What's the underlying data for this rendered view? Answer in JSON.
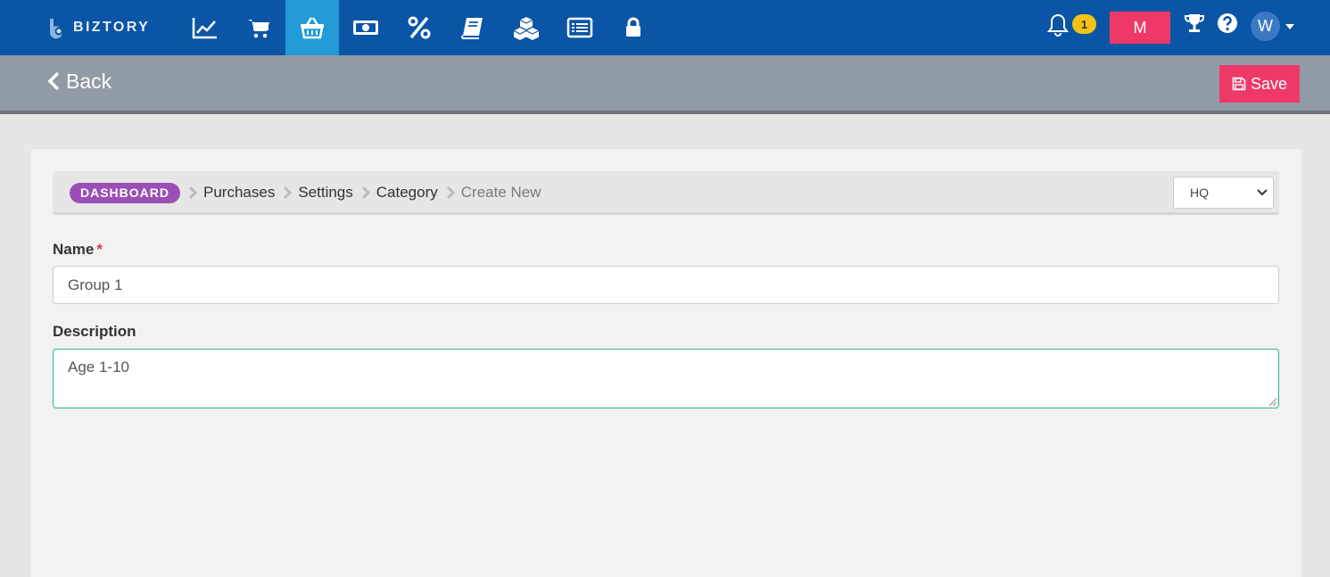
{
  "brand": {
    "name": "BIZTORY"
  },
  "nav": {
    "items": [
      {
        "icon": "chart-line-icon"
      },
      {
        "icon": "cart-icon"
      },
      {
        "icon": "basket-icon",
        "active": true
      },
      {
        "icon": "money-icon"
      },
      {
        "icon": "percent-icon"
      },
      {
        "icon": "book-icon"
      },
      {
        "icon": "boxes-icon"
      },
      {
        "icon": "list-icon"
      },
      {
        "icon": "lock-icon"
      }
    ]
  },
  "topright": {
    "notification_count": "1",
    "m_button": "M",
    "avatar_letter": "W"
  },
  "subheader": {
    "back_label": "Back",
    "save_label": "Save"
  },
  "breadcrumb": {
    "dashboard": "DASHBOARD",
    "items": [
      "Purchases",
      "Settings",
      "Category"
    ],
    "current": "Create New"
  },
  "branch_select": {
    "value": "HQ"
  },
  "form": {
    "name_label": "Name",
    "required_mark": "*",
    "name_value": "Group 1",
    "description_label": "Description",
    "description_value": "Age 1-10"
  },
  "colors": {
    "topbar": "#0a55a5",
    "active_nav": "#229ad6",
    "accent_pink": "#ee3968",
    "pill_purple": "#9b4fb6",
    "badge_yellow": "#f2c315",
    "focus_green": "#2bb58f"
  }
}
